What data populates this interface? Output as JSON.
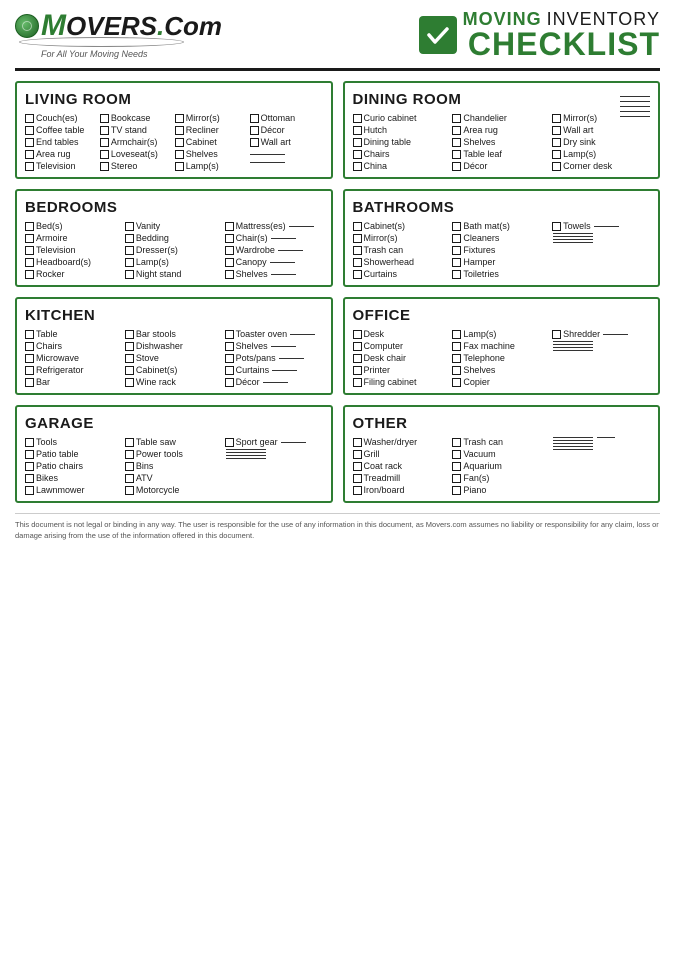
{
  "header": {
    "logo_m": "M",
    "logo_rest": "overs",
    "logo_dot": ".",
    "logo_com": "Com",
    "logo_tagline": "For All Your Moving Needs",
    "title_moving": "MOVING",
    "title_inventory": "INVENTORY",
    "title_checklist": "CHECKLIST"
  },
  "sections": {
    "living_room": {
      "title": "LIVING ROOM",
      "col1": [
        "Couch(es)",
        "Coffee table",
        "End tables",
        "Area rug",
        "Television"
      ],
      "col2": [
        "Bookcase",
        "TV stand",
        "Armchair(s)",
        "Loveseat(s)",
        "Stereo"
      ],
      "col3": [
        "Mirror(s)",
        "Recliner",
        "Cabinet",
        "Shelves",
        "Lamp(s)"
      ],
      "col4": [
        "Ottoman",
        "Décor",
        "Wall art",
        "",
        ""
      ]
    },
    "dining_room": {
      "title": "DINING ROOM",
      "col1": [
        "Curio cabinet",
        "Hutch",
        "Dining table",
        "Chairs",
        "China"
      ],
      "col2": [
        "Chandelier",
        "Area rug",
        "Shelves",
        "Table leaf",
        "Décor"
      ],
      "col3": [
        "Mirror(s)",
        "Wall art",
        "Dry sink",
        "Lamp(s)",
        "Corner desk"
      ]
    },
    "bedrooms": {
      "title": "BEDROOMS",
      "col1": [
        "Bed(s)",
        "Armoire",
        "Television",
        "Headboard(s)",
        "Rocker"
      ],
      "col2": [
        "Vanity",
        "Bedding",
        "Dresser(s)",
        "Lamp(s)",
        "Night stand"
      ],
      "col3": [
        "Mattress(es)",
        "Chair(s)",
        "Wardrobe",
        "Canopy",
        "Shelves"
      ]
    },
    "bathrooms": {
      "title": "BATHROOMS",
      "col1": [
        "Cabinet(s)",
        "Mirror(s)",
        "Trash can",
        "Showerhead",
        "Curtains"
      ],
      "col2": [
        "Bath mat(s)",
        "Cleaners",
        "Fixtures",
        "Hamper",
        "Toiletries"
      ],
      "col3": [
        "Towels",
        "",
        "",
        "",
        ""
      ]
    },
    "kitchen": {
      "title": "KITCHEN",
      "col1": [
        "Table",
        "Chairs",
        "Microwave",
        "Refrigerator",
        "Bar"
      ],
      "col2": [
        "Bar stools",
        "Dishwasher",
        "Stove",
        "Cabinet(s)",
        "Wine rack"
      ],
      "col3": [
        "Toaster oven",
        "Shelves",
        "Pots/pans",
        "Curtains",
        "Décor"
      ]
    },
    "office": {
      "title": "OFFICE",
      "col1": [
        "Desk",
        "Computer",
        "Desk chair",
        "Printer",
        "Filing cabinet"
      ],
      "col2": [
        "Lamp(s)",
        "Fax machine",
        "Telephone",
        "Shelves",
        "Copier"
      ],
      "col3": [
        "Shredder",
        "",
        "",
        "",
        ""
      ]
    },
    "garage": {
      "title": "GARAGE",
      "col1": [
        "Tools",
        "Patio table",
        "Patio chairs",
        "Bikes",
        "Lawnmower"
      ],
      "col2": [
        "Table saw",
        "Power tools",
        "Bins",
        "ATV",
        "Motorcycle"
      ],
      "col3": [
        "Sport gear",
        "",
        "",
        "",
        ""
      ]
    },
    "other": {
      "title": "OTHER",
      "col1": [
        "Washer/dryer",
        "Grill",
        "Coat rack",
        "Treadmill",
        "Iron/board"
      ],
      "col2": [
        "Trash can",
        "Vacuum",
        "Aquarium",
        "Fan(s)",
        "Piano"
      ]
    }
  },
  "footer": {
    "text": "This document is not legal or binding in any way. The user is responsible for the use of any information in this document, as Movers.com assumes no liability or responsibility for any claim, loss or damage arising from the use of the information offered in this document."
  }
}
